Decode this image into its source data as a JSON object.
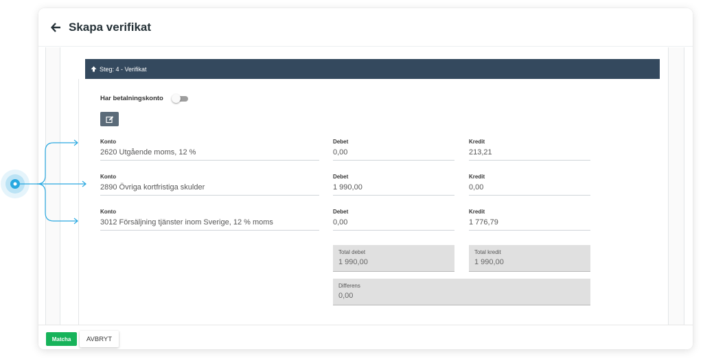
{
  "header": {
    "title": "Skapa verifikat"
  },
  "step": {
    "label": "Steg: 4 - Verifikat"
  },
  "payment_toggle": {
    "label": "Har betalningskonto",
    "enabled": false
  },
  "icons": {
    "back": "arrow-left-icon",
    "step": "arrow-up-icon",
    "edit": "edit-icon"
  },
  "rows": [
    {
      "konto_label": "Konto",
      "konto": "2620 Utgående moms, 12 %",
      "debet_label": "Debet",
      "debet": "0,00",
      "kredit_label": "Kredit",
      "kredit": "213,21"
    },
    {
      "konto_label": "Konto",
      "konto": "2890 Övriga kortfristiga skulder",
      "debet_label": "Debet",
      "debet": "1 990,00",
      "kredit_label": "Kredit",
      "kredit": "0,00"
    },
    {
      "konto_label": "Konto",
      "konto": "3012 Försäljning tjänster inom Sverige, 12 % moms",
      "debet_label": "Debet",
      "debet": "0,00",
      "kredit_label": "Kredit",
      "kredit": "1 776,79"
    }
  ],
  "totals": {
    "debet_label": "Total debet",
    "debet": "1 990,00",
    "kredit_label": "Total kredit",
    "kredit": "1 990,00",
    "diff_label": "Differens",
    "diff": "0,00"
  },
  "footer": {
    "match_label": "Matcha",
    "cancel_label": "AVBRYT"
  },
  "colors": {
    "step_bar": "#34495e",
    "match": "#17b35a",
    "annotation": "#29a8e0"
  }
}
